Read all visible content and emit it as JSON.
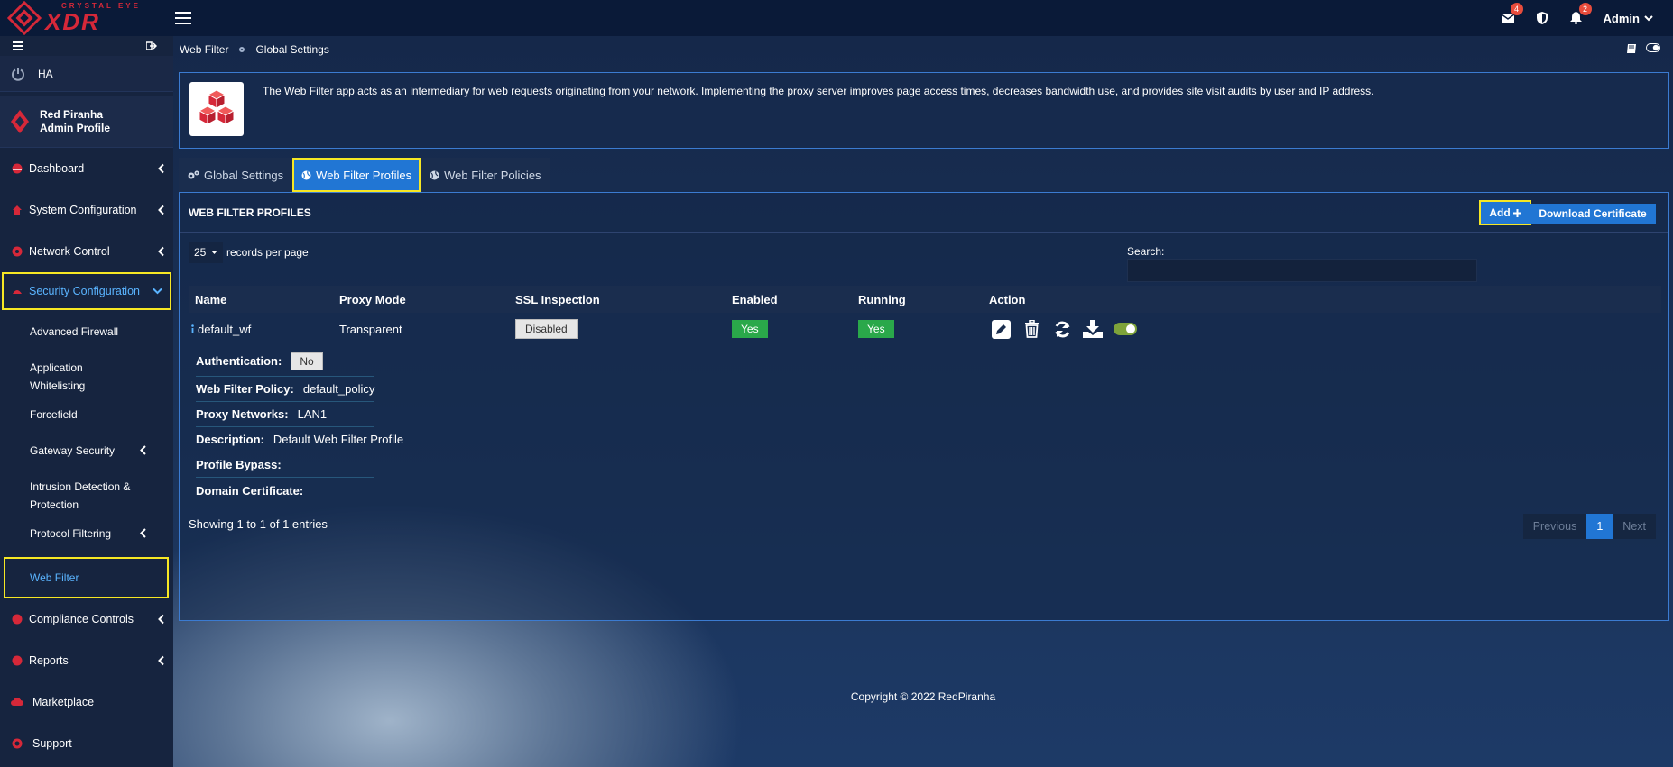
{
  "brand": {
    "top": "CRYSTAL EYE",
    "main": "XDR",
    "color": "#d62839"
  },
  "topbar": {
    "mail_badge": "4",
    "bell_badge": "2",
    "user": "Admin"
  },
  "sidebar": {
    "ha": "HA",
    "profile": {
      "line1": "Red Piranha",
      "line2": "Admin Profile"
    },
    "nav": [
      {
        "label": "Dashboard"
      },
      {
        "label": "System Configuration"
      },
      {
        "label": "Network Control"
      },
      {
        "label": "Security Configuration"
      }
    ],
    "sub": [
      {
        "label": "Advanced Firewall"
      },
      {
        "label": "Application Whitelisting"
      },
      {
        "label": "Forcefield"
      },
      {
        "label": "Gateway Security"
      },
      {
        "label": "Intrusion Detection & Protection"
      },
      {
        "label": "Protocol Filtering"
      },
      {
        "label": "Web Filter"
      }
    ],
    "nav_bottom": [
      {
        "label": "Compliance Controls"
      },
      {
        "label": "Reports"
      },
      {
        "label": "Marketplace"
      },
      {
        "label": "Support"
      }
    ]
  },
  "breadcrumb": {
    "root": "Web Filter",
    "current": "Global Settings"
  },
  "info": {
    "text": "The Web Filter app acts as an intermediary for web requests originating from your network. Implementing the proxy server improves page access times, decreases bandwidth use, and provides site visit audits by user and IP address."
  },
  "tabs": [
    {
      "label": "Global Settings"
    },
    {
      "label": "Web Filter Profiles"
    },
    {
      "label": "Web Filter Policies"
    }
  ],
  "panel": {
    "title": "WEB FILTER PROFILES",
    "add_label": "Add",
    "download_label": "Download Certificate",
    "length_value": "25",
    "length_suffix": "records per page",
    "search_label": "Search:",
    "columns": [
      "Name",
      "Proxy Mode",
      "SSL Inspection",
      "Enabled",
      "Running",
      "Action"
    ],
    "row": {
      "name": "default_wf",
      "proxy_mode": "Transparent",
      "ssl": "Disabled",
      "enabled": "Yes",
      "running": "Yes"
    },
    "details": {
      "auth_label": "Authentication:",
      "auth_value": "No",
      "policy_label": "Web Filter Policy:",
      "policy_value": "default_policy",
      "networks_label": "Proxy Networks:",
      "networks_value": "LAN1",
      "desc_label": "Description:",
      "desc_value": "Default Web Filter Profile",
      "bypass_label": "Profile Bypass:",
      "cert_label": "Domain Certificate:"
    },
    "showing": "Showing 1 to 1 of 1 entries",
    "pager": {
      "prev": "Previous",
      "page": "1",
      "next": "Next"
    }
  },
  "footer": {
    "copyright": "Copyright © 2022 RedPiranha"
  },
  "colors": {
    "accent": "#2176d4",
    "highlight": "#f6e724",
    "success": "#2aa84a",
    "danger": "#d62839"
  }
}
